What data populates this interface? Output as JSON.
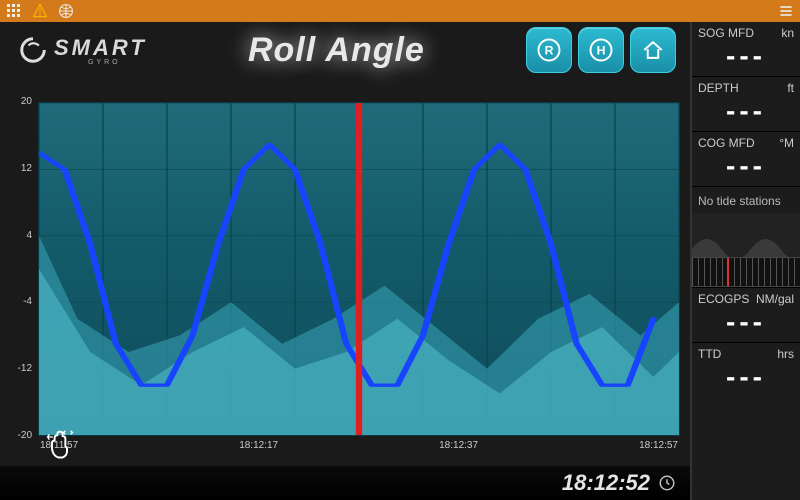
{
  "toolbar": {
    "apps_icon": "grid",
    "warning_icon": "warning",
    "globe_icon": "globe",
    "menu_icon": "menu"
  },
  "logo": {
    "brand": "SMART",
    "sub": "GYRO"
  },
  "title": "Roll Angle",
  "header_buttons": {
    "r_label": "R",
    "h_label": "H",
    "home_label": "home"
  },
  "chart_data": {
    "type": "line",
    "title": "Roll Angle",
    "xlabel": "",
    "ylabel": "",
    "ylim": [
      -20,
      20
    ],
    "y_ticks": [
      20,
      12,
      4,
      -4,
      -12,
      -20
    ],
    "x_ticks": [
      "18:11:57",
      "18:12:17",
      "18:12:37",
      "18:12:57"
    ],
    "cursor_x": 0.5,
    "series": [
      {
        "name": "roll_deg",
        "color": "#1744ff",
        "x": [
          0.0,
          0.04,
          0.08,
          0.12,
          0.16,
          0.2,
          0.24,
          0.28,
          0.32,
          0.36,
          0.4,
          0.44,
          0.48,
          0.52,
          0.56,
          0.6,
          0.64,
          0.68,
          0.72,
          0.76,
          0.8,
          0.84,
          0.88,
          0.92,
          0.96
        ],
        "y": [
          14,
          12,
          3,
          -9,
          -14,
          -14,
          -8,
          3,
          12,
          15,
          12,
          3,
          -9,
          -14,
          -14,
          -8,
          3,
          12,
          15,
          12,
          3,
          -9,
          -14,
          -14,
          -6
        ]
      }
    ],
    "background_bands": [
      {
        "color": "#3aa9bb88",
        "x": [
          0,
          0.06,
          0.14,
          0.22,
          0.3,
          0.38,
          0.46,
          0.54,
          0.62,
          0.7,
          0.78,
          0.86,
          0.94,
          1.0
        ],
        "y": [
          4,
          -6,
          -10,
          -8,
          -4,
          -9,
          -6,
          -2,
          -7,
          -12,
          -6,
          -3,
          -8,
          -4
        ]
      },
      {
        "color": "#54c2d288",
        "x": [
          0,
          0.08,
          0.16,
          0.24,
          0.32,
          0.4,
          0.48,
          0.56,
          0.64,
          0.72,
          0.8,
          0.88,
          0.96,
          1.0
        ],
        "y": [
          0,
          -10,
          -14,
          -10,
          -7,
          -12,
          -10,
          -6,
          -11,
          -15,
          -10,
          -7,
          -13,
          -10
        ]
      }
    ]
  },
  "gesture": {
    "pan": "pan",
    "pinch": "pinch"
  },
  "clock": "18:12:52",
  "sidebar": {
    "cells": [
      {
        "label": "SOG MFD",
        "unit": "kn",
        "value": "---"
      },
      {
        "label": "DEPTH",
        "unit": "ft",
        "value": "---"
      },
      {
        "label": "COG MFD",
        "unit": "°M",
        "value": "---"
      }
    ],
    "tide_msg": "No tide stations",
    "eco": {
      "label": "ECOGPS",
      "unit": "NM/gal",
      "value": "---"
    },
    "ttd": {
      "label": "TTD",
      "unit": "hrs",
      "value": "---"
    }
  }
}
